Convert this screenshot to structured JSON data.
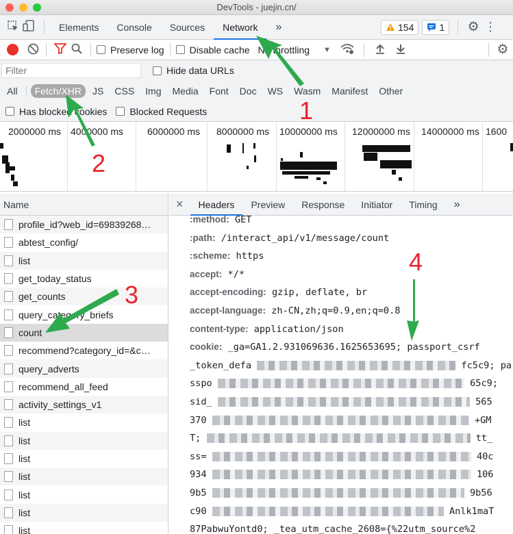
{
  "window": {
    "title": "DevTools - juejin.cn/"
  },
  "main_tabs": [
    "Elements",
    "Console",
    "Sources",
    "Network"
  ],
  "more_tabs": "»",
  "badges": {
    "warnings": "154",
    "messages": "1"
  },
  "toolbar": {
    "preserve_log": "Preserve log",
    "disable_cache": "Disable cache",
    "throttling": "No throttling"
  },
  "filter": {
    "placeholder": "Filter",
    "hide_data_urls": "Hide data URLs"
  },
  "types": [
    "All",
    "Fetch/XHR",
    "JS",
    "CSS",
    "Img",
    "Media",
    "Font",
    "Doc",
    "WS",
    "Wasm",
    "Manifest",
    "Other"
  ],
  "checkbox_row": {
    "blocked_cookies": "Has blocked cookies",
    "blocked_requests": "Blocked Requests"
  },
  "timeline_ticks": [
    "2000000 ms",
    "4000000 ms",
    "6000000 ms",
    "8000000 ms",
    "10000000 ms",
    "12000000 ms",
    "14000000 ms",
    "1600"
  ],
  "name_header": "Name",
  "requests": [
    "profile_id?web_id=69839268…",
    "abtest_config/",
    "list",
    "get_today_status",
    "get_counts",
    "query_category_briefs",
    "count",
    "recommend?category_id=&c…",
    "query_adverts",
    "recommend_all_feed",
    "activity_settings_v1",
    "list",
    "list",
    "list",
    "list",
    "list",
    "list",
    "list"
  ],
  "detail_tabs": [
    "Headers",
    "Preview",
    "Response",
    "Initiator",
    "Timing"
  ],
  "close_glyph": "×",
  "headers": {
    "method_k": ":method:",
    "method_v": "GET",
    "path_k": ":path:",
    "path_v": "/interact_api/v1/message/count",
    "scheme_k": ":scheme:",
    "scheme_v": "https",
    "accept_k": "accept:",
    "accept_v": "*/*",
    "enc_k": "accept-encoding:",
    "enc_v": "gzip, deflate, br",
    "lang_k": "accept-language:",
    "lang_v": "zh-CN,zh;q=0.9,en;q=0.8",
    "ctype_k": "content-type:",
    "ctype_v": "application/json",
    "cookie_k": "cookie:",
    "cookie_v": "_ga=GA1.2.931069636.1625653695; passport_csrf",
    "c1": "_token_defa",
    "c1e": "fc5c9; pa",
    "c2": "sspo",
    "c2e": "65c9;",
    "c3": "sid_",
    "c3e": "565",
    "c4": "370",
    "c4e": "+GM",
    "c5": "T;",
    "c5e": "tt_",
    "c6": "ss=",
    "c6e": "40c",
    "c7": "934",
    "c7e": "106",
    "c8": "9b5",
    "c8e": "9b56",
    "c9": "c90",
    "c9e": "Anlk1maT",
    "c10": "87PabwuYontd0; _tea_utm_cache_2608={%22utm_source%2"
  },
  "annotations": [
    "1",
    "2",
    "3",
    "4"
  ],
  "colors": {
    "accent": "#1a73e8",
    "annotation_red": "#e8242c",
    "arrow_green": "#2eaa4e",
    "record_red": "#e8332c"
  }
}
